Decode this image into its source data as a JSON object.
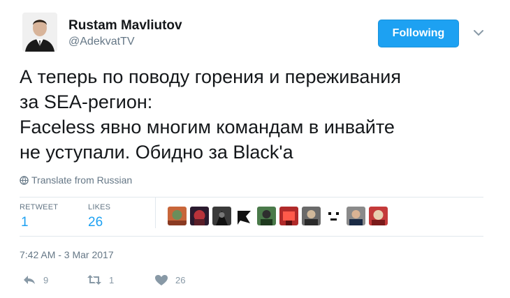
{
  "header": {
    "display_name": "Rustam Mavliutov",
    "handle": "@AdekvatTV",
    "follow_label": "Following"
  },
  "tweet": {
    "text": "А теперь по поводу горения и переживания\nза SEA-регион:\nFaceless явно многим командам в инвайте\nне уступали. Обидно за Black'a",
    "translate_label": "Translate from Russian",
    "timestamp": "7:42 AM - 3 Mar 2017"
  },
  "stats": {
    "retweets_label": "RETWEET",
    "retweets_value": "1",
    "likes_label": "LIKES",
    "likes_value": "26"
  },
  "actions": {
    "reply_count": "9",
    "retweet_count": "1",
    "like_count": "26"
  },
  "colors": {
    "accent": "#1da1f2",
    "muted": "#657786",
    "icon": "#8899a6",
    "text": "#14171a"
  }
}
